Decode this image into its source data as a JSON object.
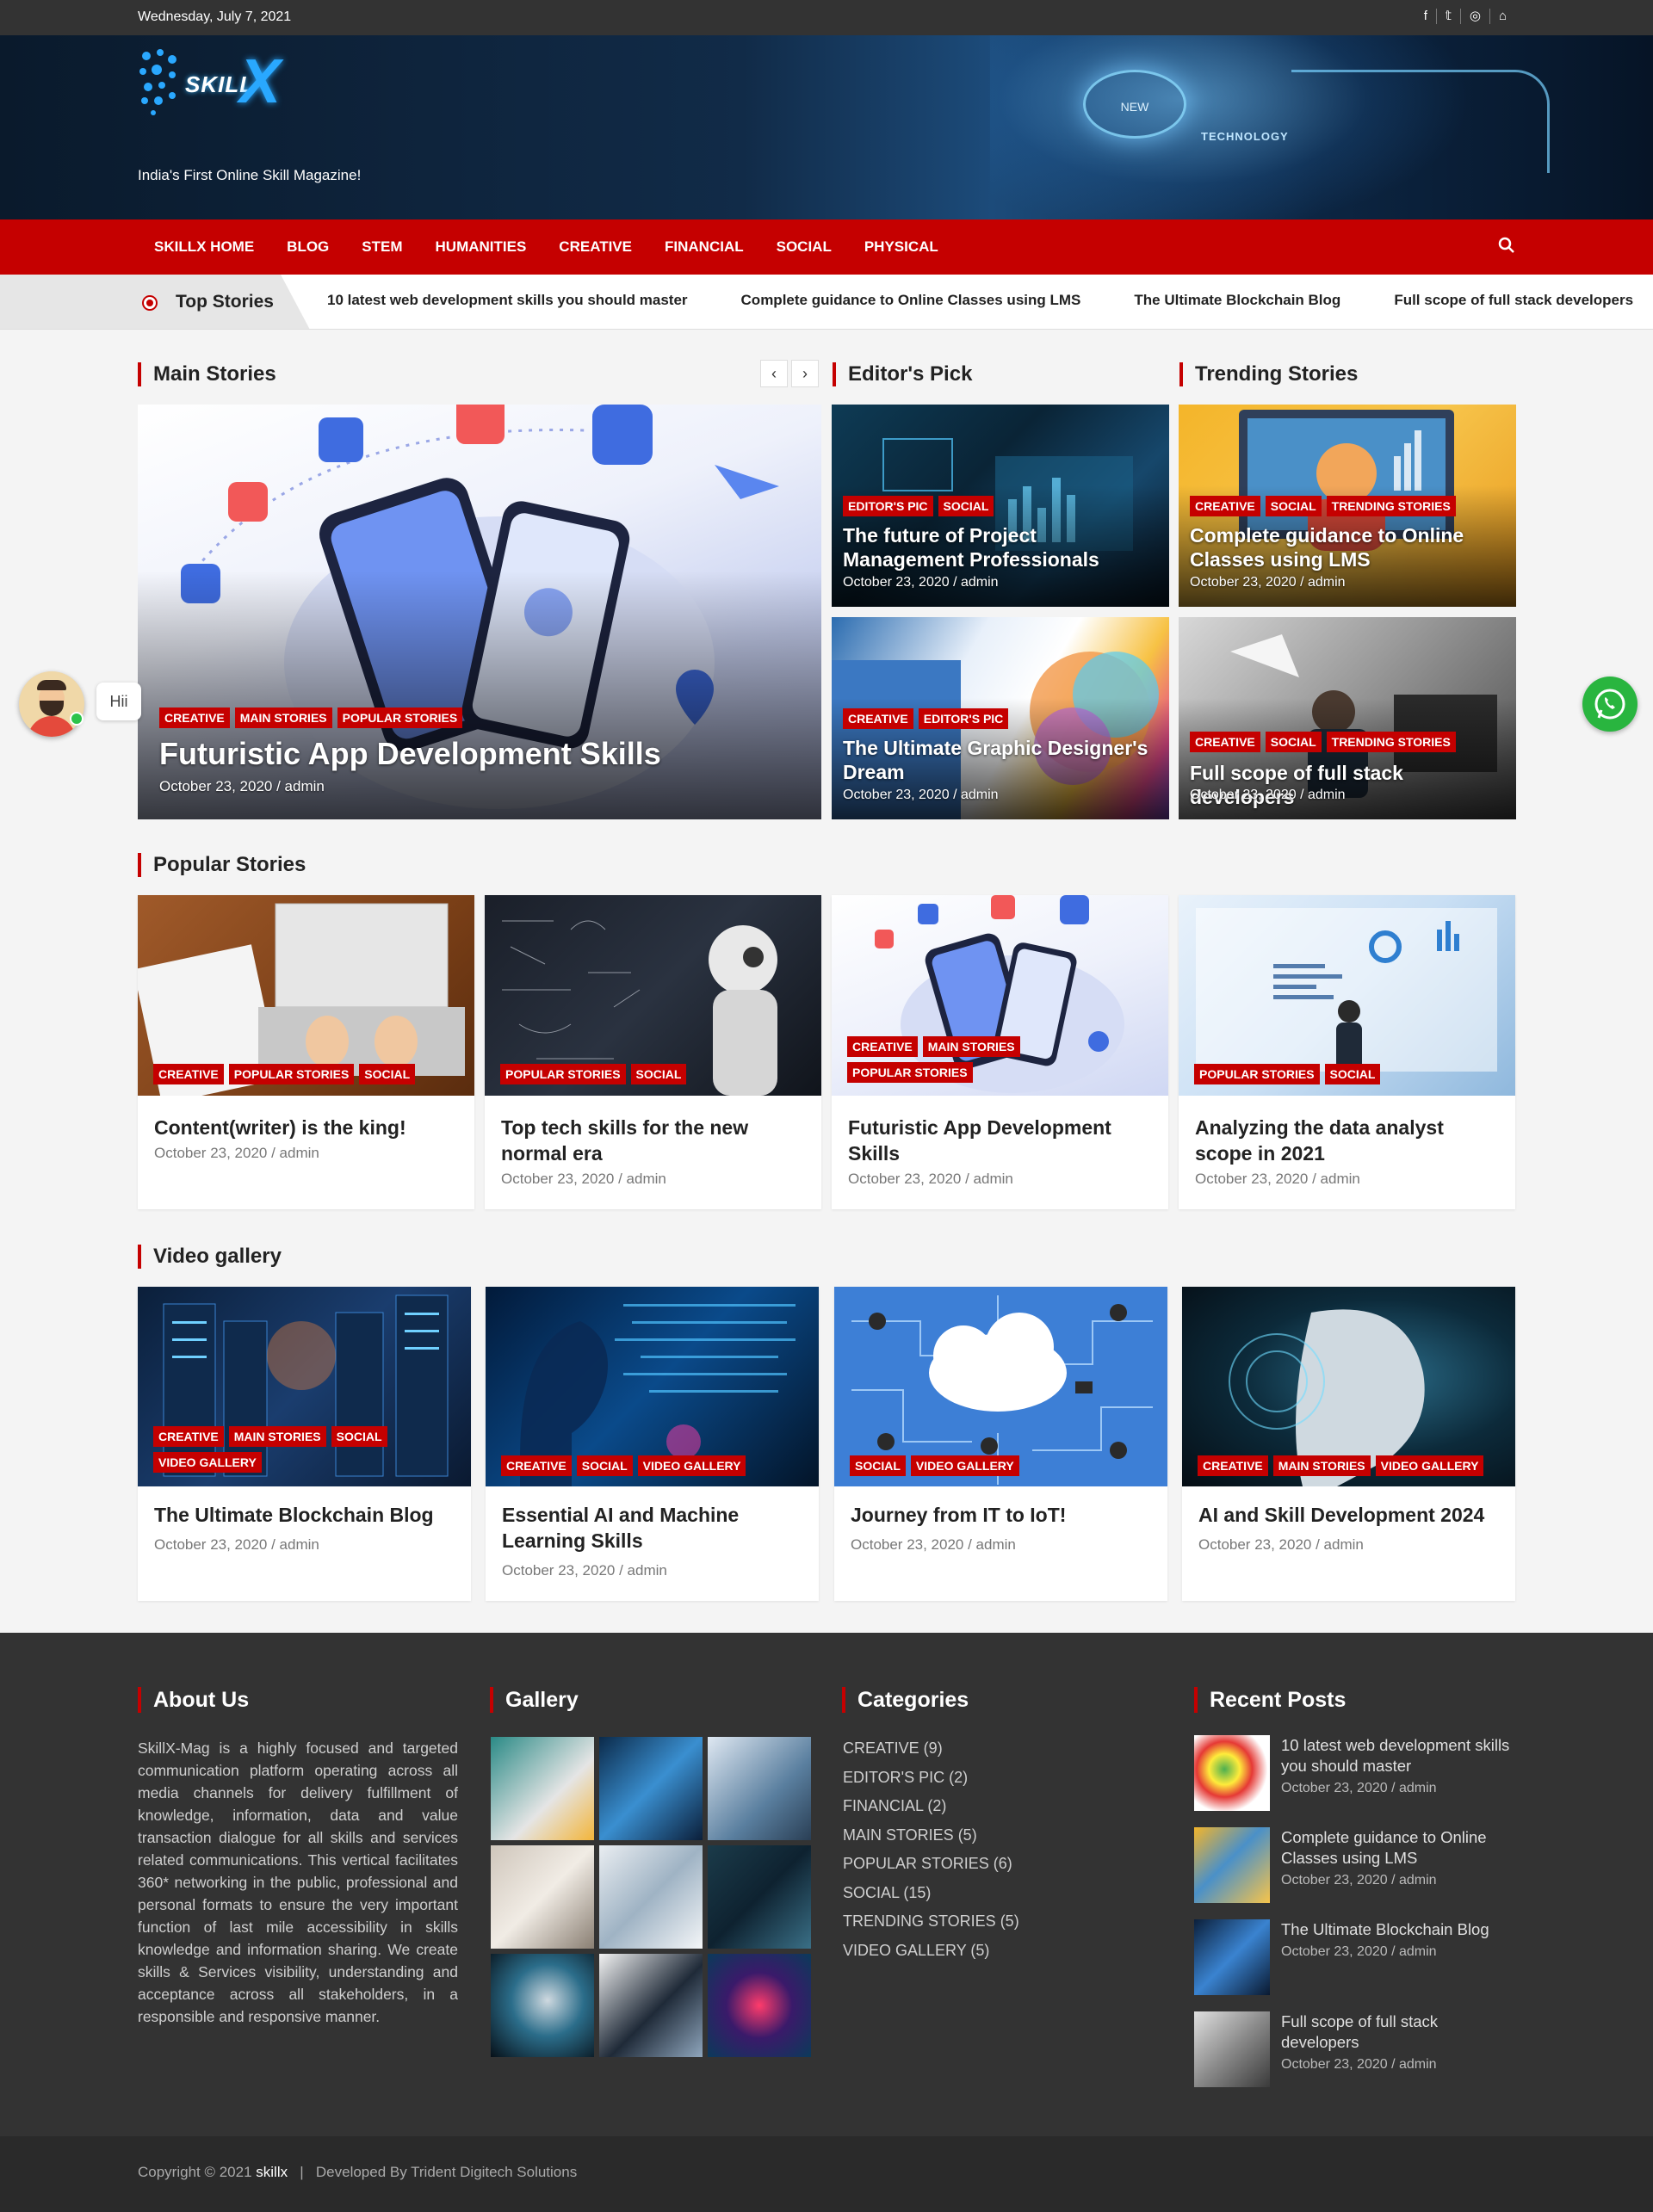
{
  "topbar": {
    "date": "Wednesday, July 7, 2021",
    "social_icons": [
      "facebook-icon",
      "twitter-icon",
      "instagram-icon",
      "home-icon"
    ]
  },
  "header": {
    "logo_text": "SKILL",
    "logo_letter": "X",
    "tagline": "India's First Online Skill Magazine!",
    "banner_badge": "NEW",
    "banner_label": "TECHNOLOGY"
  },
  "nav": {
    "items": [
      "SKILLX HOME",
      "BLOG",
      "STEM",
      "HUMANITIES",
      "CREATIVE",
      "FINANCIAL",
      "SOCIAL",
      "PHYSICAL"
    ]
  },
  "ticker": {
    "label": "Top Stories",
    "items": [
      "10 latest web development skills you should master",
      "Complete guidance to Online Classes using LMS",
      "The Ultimate Blockchain Blog",
      "Full scope of full stack developers"
    ]
  },
  "main_stories": {
    "heading": "Main Stories",
    "prev": "‹",
    "next": "›",
    "feature": {
      "tags": [
        "CREATIVE",
        "MAIN STORIES",
        "POPULAR STORIES"
      ],
      "title": "Futuristic App Development Skills",
      "meta": "October 23, 2020 / admin"
    }
  },
  "editors_pick": {
    "heading": "Editor's Pick",
    "items": [
      {
        "tags": [
          "EDITOR'S PIC",
          "SOCIAL"
        ],
        "title": "The future of Project Management Professionals",
        "meta": "October 23, 2020 / admin"
      },
      {
        "tags": [
          "CREATIVE",
          "EDITOR'S PIC"
        ],
        "title": "The Ultimate Graphic Designer's Dream",
        "meta": "October 23, 2020 / admin"
      }
    ]
  },
  "trending": {
    "heading": "Trending Stories",
    "items": [
      {
        "tags": [
          "CREATIVE",
          "SOCIAL",
          "TRENDING STORIES"
        ],
        "title": "Complete guidance to Online Classes using LMS",
        "meta": "October 23, 2020 / admin"
      },
      {
        "tags": [
          "CREATIVE",
          "SOCIAL",
          "TRENDING STORIES"
        ],
        "title": "Full scope of full stack developers",
        "meta": "October 23, 2020 / admin"
      }
    ]
  },
  "popular": {
    "heading": "Popular Stories",
    "items": [
      {
        "tags": [
          "CREATIVE",
          "POPULAR STORIES",
          "SOCIAL"
        ],
        "title": "Content(writer) is the king!",
        "meta": "October 23, 2020 / admin"
      },
      {
        "tags": [
          "POPULAR STORIES",
          "SOCIAL"
        ],
        "title": "Top tech skills for the new normal era",
        "meta": "October 23, 2020 / admin"
      },
      {
        "tags": [
          "CREATIVE",
          "MAIN STORIES",
          "POPULAR STORIES"
        ],
        "title": "Futuristic App Development Skills",
        "meta": "October 23, 2020 / admin"
      },
      {
        "tags": [
          "POPULAR STORIES",
          "SOCIAL"
        ],
        "title": "Analyzing the data analyst scope in 2021",
        "meta": "October 23, 2020 / admin"
      }
    ]
  },
  "video": {
    "heading": "Video gallery",
    "items": [
      {
        "tags": [
          "CREATIVE",
          "MAIN STORIES",
          "SOCIAL",
          "VIDEO GALLERY"
        ],
        "title": "The Ultimate Blockchain Blog",
        "meta": "October 23, 2020 / admin"
      },
      {
        "tags": [
          "CREATIVE",
          "SOCIAL",
          "VIDEO GALLERY"
        ],
        "title": "Essential AI and Machine Learning Skills",
        "meta": "October 23, 2020 / admin"
      },
      {
        "tags": [
          "SOCIAL",
          "VIDEO GALLERY"
        ],
        "title": "Journey from IT to IoT!",
        "meta": "October 23, 2020 / admin"
      },
      {
        "tags": [
          "CREATIVE",
          "MAIN STORIES",
          "VIDEO GALLERY"
        ],
        "title": "AI and Skill Development 2024",
        "meta": "October 23, 2020 / admin"
      }
    ]
  },
  "footer": {
    "about_heading": "About Us",
    "about_text": "SkillX-Mag is a highly focused and targeted communication platform operating across all media channels for delivery fulfillment of knowledge, information, data and value transaction dialogue for all skills and services related communications. This vertical facilitates 360* networking in the public, professional and personal formats to ensure the very important function of last mile accessibility in skills knowledge and information sharing. We create skills & Services visibility, understanding and acceptance across all stakeholders, in a responsible and responsive manner.",
    "gallery_heading": "Gallery",
    "categories_heading": "Categories",
    "categories": [
      "CREATIVE (9)",
      "EDITOR'S PIC (2)",
      "FINANCIAL (2)",
      "MAIN STORIES (5)",
      "POPULAR STORIES (6)",
      "SOCIAL (15)",
      "TRENDING STORIES (5)",
      "VIDEO GALLERY (5)"
    ],
    "recent_heading": "Recent Posts",
    "recent": [
      {
        "title": "10 latest web development skills you should master",
        "meta": "October 23, 2020 / admin"
      },
      {
        "title": "Complete guidance to Online Classes using LMS",
        "meta": "October 23, 2020 / admin"
      },
      {
        "title": "The Ultimate Blockchain Blog",
        "meta": "October 23, 2020 / admin"
      },
      {
        "title": "Full scope of full stack developers",
        "meta": "October 23, 2020 / admin"
      }
    ]
  },
  "copyright": {
    "prefix": "Copyright © 2021 ",
    "brand": "skillx",
    "suffix": "   |   Developed By Trident Digitech Solutions"
  },
  "chat": {
    "bubble": "Hii"
  },
  "colors": {
    "accent": "#c50000",
    "dark": "#333333",
    "whatsapp": "#29b53f"
  }
}
